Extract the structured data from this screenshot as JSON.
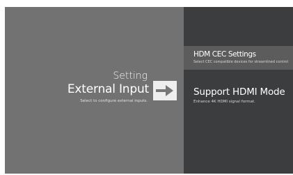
{
  "left_panel": {
    "setting_label": "Setting",
    "section_title": "External Input",
    "section_hint": "Select to configure external inputs."
  },
  "navigation": {
    "arrow_icon": "right-arrow-icon"
  },
  "menu": {
    "items": [
      {
        "title": "HDM CEC Settings",
        "description": "Select CEC compatible devices for streamlined control",
        "focused": true
      },
      {
        "title": "Support HDMI Mode",
        "description": "Enhance 4K HDMI signal format.",
        "focused": false
      }
    ]
  },
  "colors": {
    "left_background": "#727272",
    "right_background": "#3c3d3f",
    "focus_background": "#5c5c5c",
    "text": "#ffffff"
  }
}
